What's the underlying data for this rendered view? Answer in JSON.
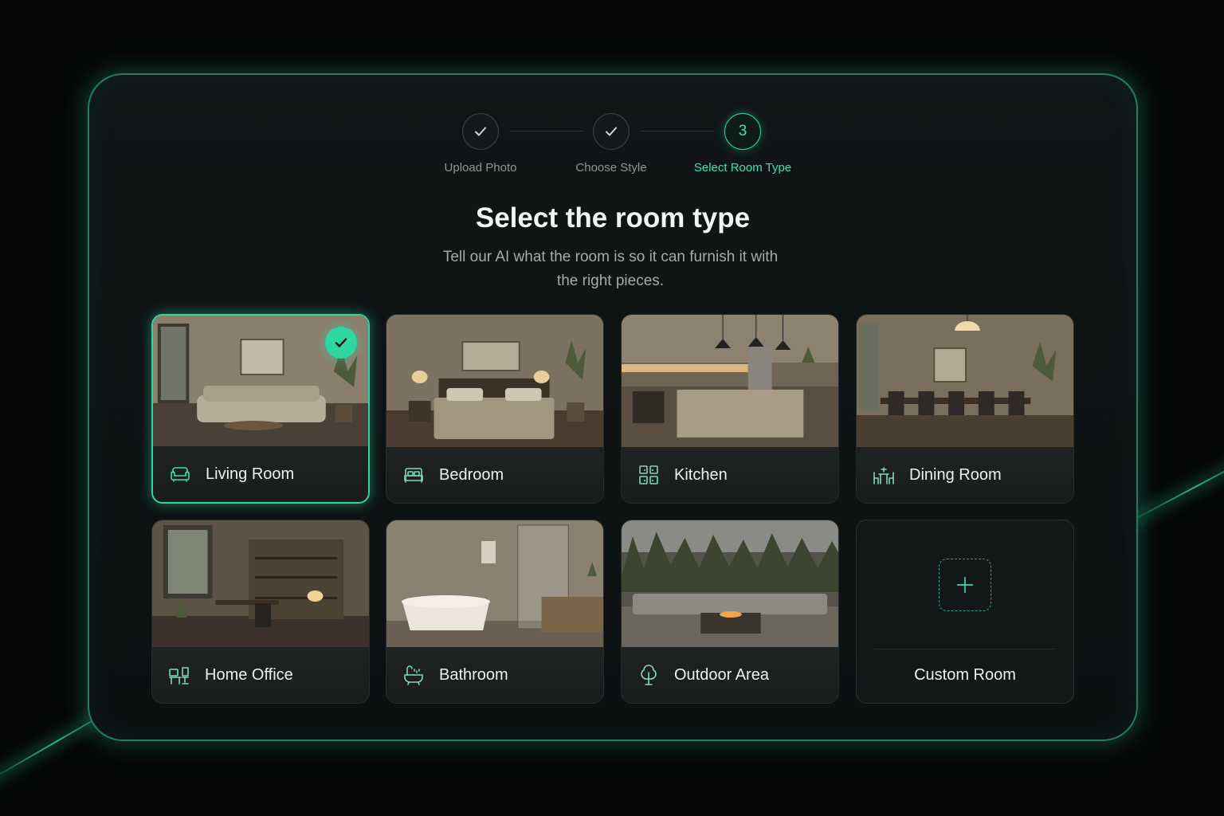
{
  "stepper": {
    "steps": [
      {
        "label": "Upload Photo",
        "state": "done"
      },
      {
        "label": "Choose Style",
        "state": "done"
      },
      {
        "label": "Select Room Type",
        "number": "3",
        "state": "active"
      }
    ]
  },
  "heading": {
    "title": "Select the room type",
    "subtitle": "Tell our AI what the room is so it can furnish it with the right pieces."
  },
  "rooms": [
    {
      "name": "Living Room",
      "icon": "sofa-icon",
      "selected": true
    },
    {
      "name": "Bedroom",
      "icon": "bed-icon",
      "selected": false
    },
    {
      "name": "Kitchen",
      "icon": "kitchen-cabinet-icon",
      "selected": false
    },
    {
      "name": "Dining Room",
      "icon": "dining-table-icon",
      "selected": false
    },
    {
      "name": "Home Office",
      "icon": "desk-chair-icon",
      "selected": false
    },
    {
      "name": "Bathroom",
      "icon": "bathtub-icon",
      "selected": false
    },
    {
      "name": "Outdoor Area",
      "icon": "tree-icon",
      "selected": false
    },
    {
      "name": "Custom Room",
      "icon": "plus-icon",
      "selected": false
    }
  ],
  "colors": {
    "accent": "#2fd6a0",
    "background": "#050708",
    "card": "#0e1314"
  }
}
